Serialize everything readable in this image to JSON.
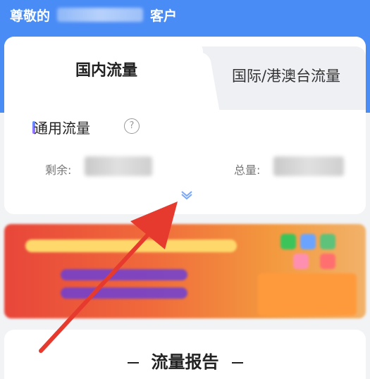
{
  "header": {
    "greeting_prefix": "尊敬的",
    "greeting_suffix": "客户"
  },
  "tabs": [
    {
      "label": "国内流量",
      "active": true
    },
    {
      "label": "国际/港澳台流量",
      "active": false
    }
  ],
  "section": {
    "title": "通用流量",
    "help_icon": "question-circle-icon",
    "remaining_label": "剩余:",
    "total_label": "总量:",
    "expand_icon": "chevron-down-icon"
  },
  "report": {
    "title": "流量报告"
  },
  "colors": {
    "header_blue": "#4a8cf6",
    "accent_red": "#e63a2e"
  }
}
